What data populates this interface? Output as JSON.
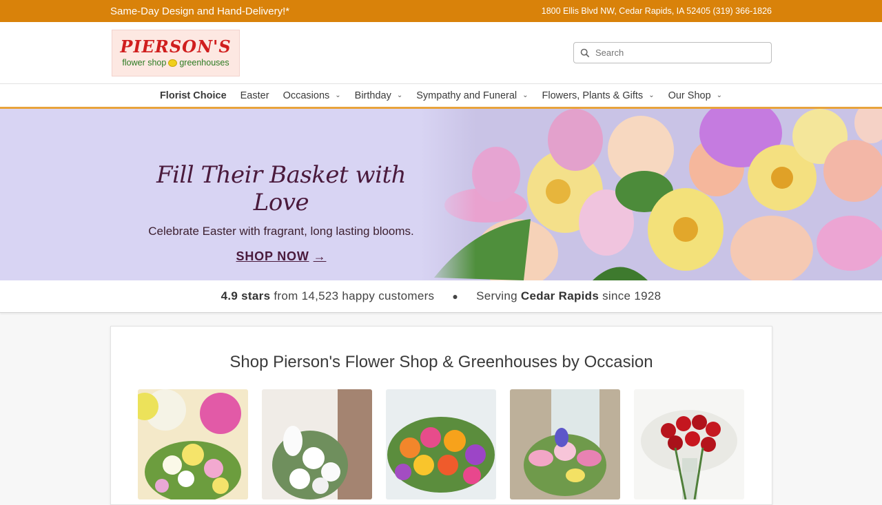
{
  "topbar": {
    "promo": "Same-Day Design and Hand-Delivery!*",
    "address": "1800 Ellis Blvd NW, Cedar Rapids, IA 52405",
    "phone": "(319) 366-1826"
  },
  "header": {
    "logo_name": "PIERSON'S",
    "logo_sub_left": "flower shop",
    "logo_sub_right": "greenhouses",
    "search_placeholder": "Search"
  },
  "nav": {
    "items": [
      {
        "label": "Florist Choice",
        "dropdown": false
      },
      {
        "label": "Easter",
        "dropdown": false
      },
      {
        "label": "Occasions",
        "dropdown": true
      },
      {
        "label": "Birthday",
        "dropdown": true
      },
      {
        "label": "Sympathy and Funeral",
        "dropdown": true
      },
      {
        "label": "Flowers, Plants & Gifts",
        "dropdown": true
      },
      {
        "label": "Our Shop",
        "dropdown": true
      }
    ]
  },
  "hero": {
    "title": "Fill Their Basket with Love",
    "subtitle": "Celebrate Easter with fragrant, long lasting blooms.",
    "cta": "SHOP NOW"
  },
  "rating": {
    "stars": "4.9 stars",
    "customers": "from 14,523 happy customers",
    "serving_prefix": "Serving",
    "city": "Cedar Rapids",
    "since": "since 1928"
  },
  "occasion": {
    "title": "Shop Pierson's Flower Shop & Greenhouses by Occasion"
  },
  "colors": {
    "topbar": "#d9820a",
    "nav_underline": "#e8a33b",
    "hero_bg": "#d8d4f3",
    "hero_text": "#4a1a3c"
  }
}
